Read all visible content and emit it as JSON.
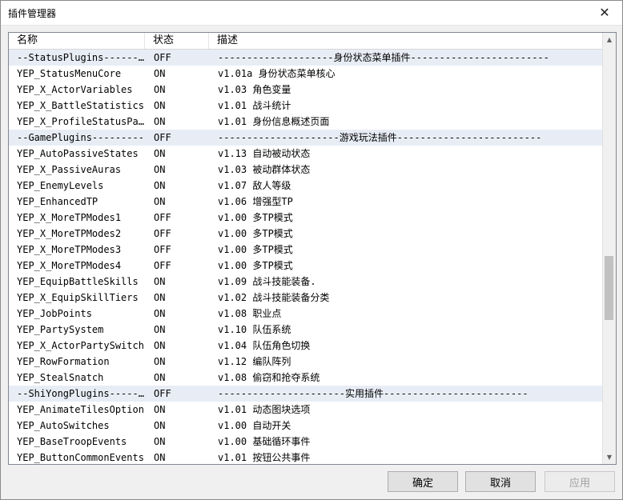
{
  "window": {
    "title": "插件管理器"
  },
  "columns": {
    "name": "名称",
    "status": "状态",
    "desc": "描述"
  },
  "rows": [
    {
      "name": "--StatusPlugins------------",
      "status": "OFF",
      "desc": "--------------------身份状态菜单插件------------------------",
      "sep": true
    },
    {
      "name": "YEP_StatusMenuCore",
      "status": "ON",
      "desc": "v1.01a 身份状态菜单核心"
    },
    {
      "name": "YEP_X_ActorVariables",
      "status": "ON",
      "desc": "v1.03 角色变量"
    },
    {
      "name": "YEP_X_BattleStatistics",
      "status": "ON",
      "desc": "v1.01 战斗统计"
    },
    {
      "name": "YEP_X_ProfileStatusPage",
      "status": "ON",
      "desc": "v1.01 身份信息概述页面"
    },
    {
      "name": "--GamePlugins---------",
      "status": "OFF",
      "desc": "---------------------游戏玩法插件-------------------------",
      "sep": true
    },
    {
      "name": "YEP_AutoPassiveStates",
      "status": "ON",
      "desc": "v1.13 自动被动状态"
    },
    {
      "name": "YEP_X_PassiveAuras",
      "status": "ON",
      "desc": "v1.03 被动群体状态"
    },
    {
      "name": "YEP_EnemyLevels",
      "status": "ON",
      "desc": "v1.07 敌人等级"
    },
    {
      "name": "YEP_EnhancedTP",
      "status": "ON",
      "desc": "v1.06 增强型TP"
    },
    {
      "name": "YEP_X_MoreTPModes1",
      "status": "OFF",
      "desc": "v1.00 多TP模式"
    },
    {
      "name": "YEP_X_MoreTPModes2",
      "status": "OFF",
      "desc": "v1.00 多TP模式"
    },
    {
      "name": "YEP_X_MoreTPModes3",
      "status": "OFF",
      "desc": "v1.00 多TP模式"
    },
    {
      "name": "YEP_X_MoreTPModes4",
      "status": "OFF",
      "desc": "v1.00 多TP模式"
    },
    {
      "name": "YEP_EquipBattleSkills",
      "status": "ON",
      "desc": "v1.09 战斗技能装备."
    },
    {
      "name": "YEP_X_EquipSkillTiers",
      "status": "ON",
      "desc": "v1.02 战斗技能装备分类"
    },
    {
      "name": "YEP_JobPoints",
      "status": "ON",
      "desc": "v1.08 职业点"
    },
    {
      "name": "YEP_PartySystem",
      "status": "ON",
      "desc": "v1.10 队伍系统"
    },
    {
      "name": "YEP_X_ActorPartySwitch",
      "status": "ON",
      "desc": "v1.04 队伍角色切换"
    },
    {
      "name": "YEP_RowFormation",
      "status": "ON",
      "desc": "v1.12 编队阵列"
    },
    {
      "name": "YEP_StealSnatch",
      "status": "ON",
      "desc": "v1.08 偷窃和抢夺系统"
    },
    {
      "name": "--ShiYongPlugins-------",
      "status": "OFF",
      "desc": "----------------------实用插件-------------------------",
      "sep": true
    },
    {
      "name": "YEP_AnimateTilesOption",
      "status": "ON",
      "desc": "v1.01 动态图块选项"
    },
    {
      "name": "YEP_AutoSwitches",
      "status": "ON",
      "desc": "v1.00 自动开关"
    },
    {
      "name": "YEP_BaseTroopEvents",
      "status": "ON",
      "desc": "v1.00 基础循环事件"
    },
    {
      "name": "YEP_ButtonCommonEvents",
      "status": "ON",
      "desc": "v1.01 按钮公共事件"
    }
  ],
  "buttons": {
    "ok": "确定",
    "cancel": "取消",
    "apply": "应用"
  },
  "icons": {
    "close": "close-icon",
    "up": "arrow-up-icon",
    "down": "arrow-down-icon"
  },
  "colors": {
    "separator_row": "#e8edf5",
    "background": "#f0f0f0"
  }
}
